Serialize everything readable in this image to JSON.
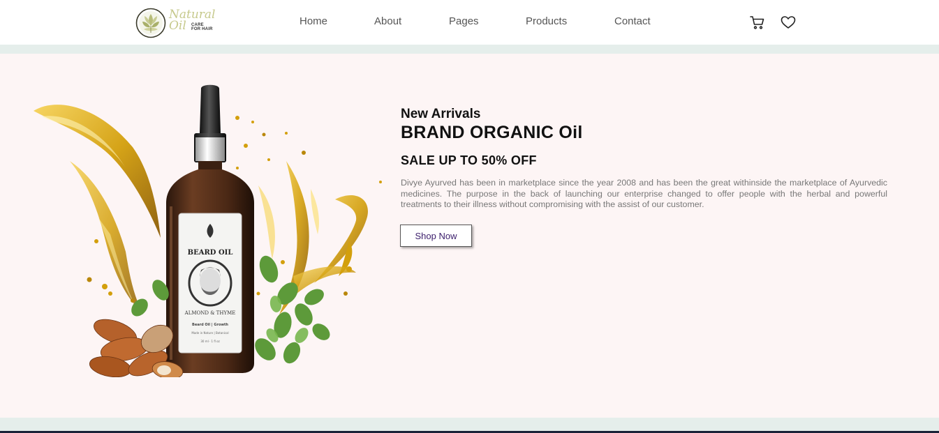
{
  "logo": {
    "script_line1": "Natural",
    "script_line2": "Oil",
    "tagline_line1": "CARE",
    "tagline_line2": "FOR HAIR"
  },
  "nav": {
    "items": [
      {
        "label": "Home"
      },
      {
        "label": "About"
      },
      {
        "label": "Pages"
      },
      {
        "label": "Products"
      },
      {
        "label": "Contact"
      }
    ]
  },
  "header_icons": {
    "cart": "cart-icon",
    "wishlist": "heart-icon"
  },
  "hero": {
    "eyebrow": "New Arrivals",
    "title": "BRAND ORGANIC Oil",
    "offer": "SALE UP TO 50% OFF",
    "description": "Divye Ayurved has been in marketplace since the year 2008 and has been the great withinside the marketplace of Ayurvedic medicines. The purpose in the back of launching our enterprise changed to offer people with the herbal and powerful treatments to their illness without compromising with the assist of our customer.",
    "cta": "Shop Now",
    "product": {
      "label_title": "BEARD OIL",
      "label_subtitle": "ALMOND & THYME",
      "label_line1": "Beard Oil | Growth",
      "label_line2": "Made in Nature | Botanical",
      "label_volume": "30 ml · 1 fl oz"
    }
  },
  "colors": {
    "hero_bg": "#fdf5f5",
    "strip": "#e5eeeb",
    "oil_gold": "#d9a90f",
    "bottle": "#4a2a1a",
    "cta_text": "#3b1d6b"
  }
}
